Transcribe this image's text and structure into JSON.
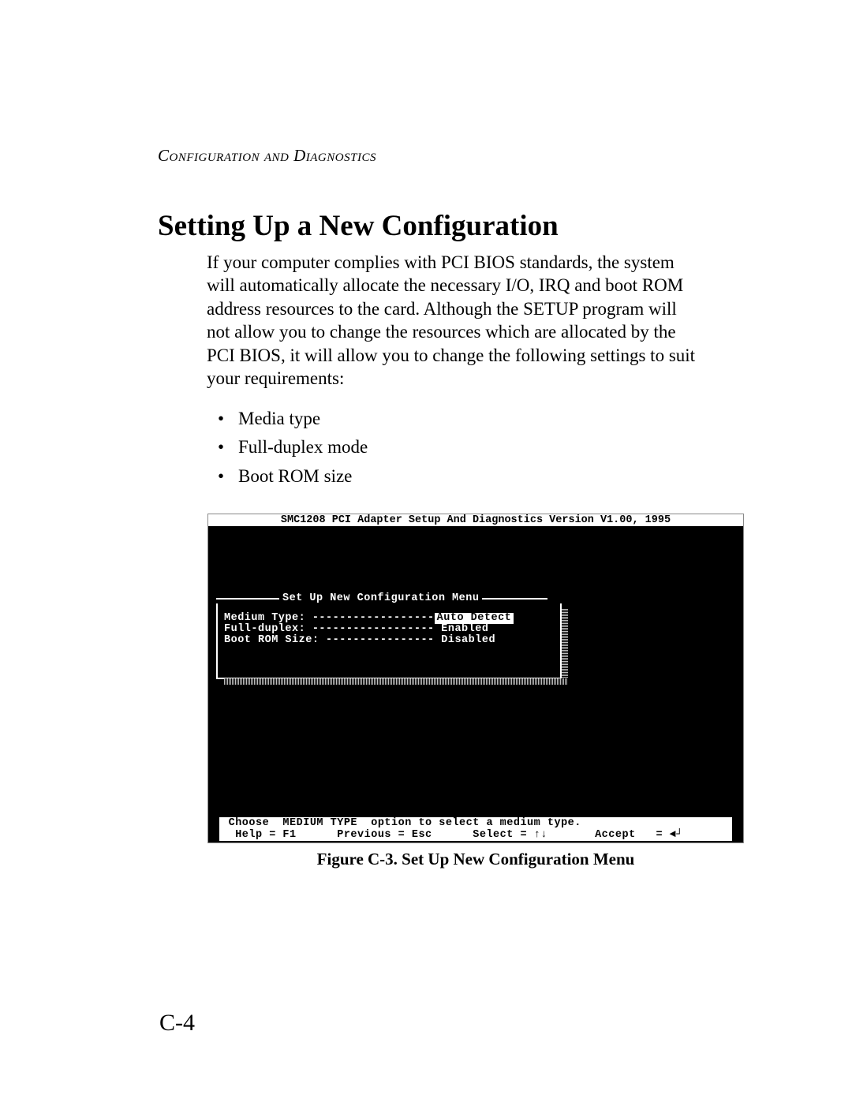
{
  "header": {
    "running": "Configuration and Diagnostics"
  },
  "section": {
    "title": "Setting Up a New Configuration",
    "paragraph": "If your computer complies with PCI BIOS standards, the system will automatically allocate the necessary I/O, IRQ and boot ROM address resources to the card.  Although the SETUP program will not allow you to change the resources which are allocated by the PCI BIOS, it will allow you to change the following settings to suit your requirements:",
    "bullets": [
      "Media type",
      "Full-duplex mode",
      "Boot ROM size"
    ]
  },
  "bios": {
    "title": "SMC1208 PCI Adapter Setup And Diagnostics Version V1.00, 1995",
    "menu_title": "Set Up New Configuration Menu",
    "rows": [
      {
        "label": "Medium Type: ------------------",
        "value": "Auto Detect",
        "selected": true
      },
      {
        "label": "Full-duplex: ------------------ ",
        "value": "Enabled",
        "selected": false
      },
      {
        "label": "Boot ROM Size: ---------------- ",
        "value": "Disabled",
        "selected": false
      }
    ],
    "help1": " Choose  MEDIUM TYPE  option to select a medium type.              ",
    "help2": "  Help = F1      Previous = Esc      Select = ↑↓       Accept   = ◄┘"
  },
  "figure": {
    "caption": "Figure C-3.  Set Up New Configuration Menu"
  },
  "page_number": "C-4"
}
